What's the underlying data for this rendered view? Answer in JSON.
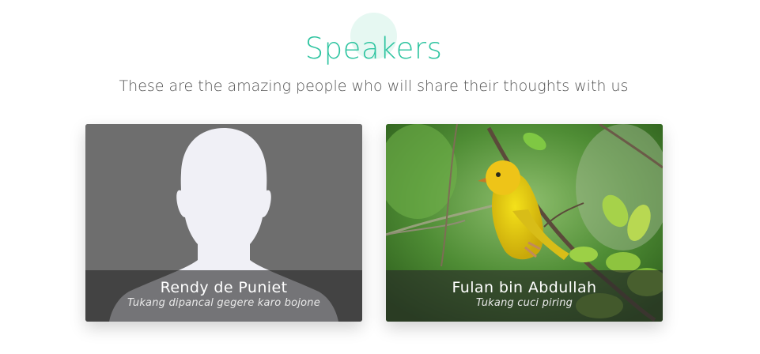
{
  "section": {
    "title": "Speakers",
    "subtitle": "These are the amazing people who will share their thoughts with us"
  },
  "speakers": [
    {
      "name": "Rendy de Puniet",
      "role": "Tukang dipancal gegere karo bojone",
      "photo": "default-avatar-silhouette"
    },
    {
      "name": "Fulan bin Abdullah",
      "role": "Tukang cuci piring",
      "photo": "yellow-bird-on-branch"
    }
  ],
  "colors": {
    "accent": "#2ec4a0",
    "text": "#555555"
  }
}
